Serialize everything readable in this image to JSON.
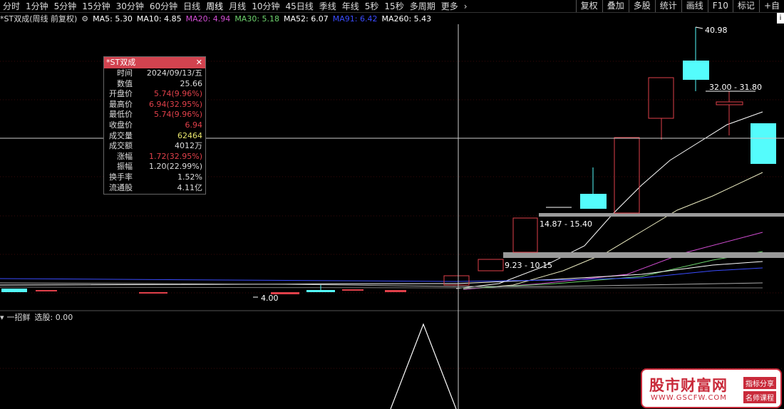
{
  "toolbar": {
    "tabs": [
      "分时",
      "1分钟",
      "5分钟",
      "15分钟",
      "30分钟",
      "60分钟",
      "日线",
      "周线",
      "月线",
      "10分钟",
      "45日线",
      "季线",
      "年线",
      "5秒",
      "15秒",
      "多周期",
      "更多"
    ],
    "active_tab": "周线",
    "right_buttons": [
      "复权",
      "叠加",
      "多股",
      "统计",
      "画线",
      "F10",
      "标记",
      "+自"
    ]
  },
  "chart": {
    "title": "*ST双成(周线 前复权)",
    "ma": [
      {
        "label": "MA5: 5.30",
        "color": "#ffffff"
      },
      {
        "label": "MA10: 4.85",
        "color": "#ffffff"
      },
      {
        "label": "MA20: 4.94",
        "color": "#d14dd2"
      },
      {
        "label": "MA30: 5.18",
        "color": "#6ed36e"
      },
      {
        "label": "MA52: 6.07",
        "color": "#ffffff"
      },
      {
        "label": "MA91: 6.42",
        "color": "#3a4cff"
      },
      {
        "label": "MA260: 5.43",
        "color": "#ffffff"
      }
    ],
    "annotations": {
      "high": "40.98",
      "range1": "32.00 - 31.80",
      "range2": "14.87 - 15.40",
      "range3": "9.23 - 10.15",
      "low": "4.00"
    },
    "up_color": "#e0404a",
    "down_color": "#54fcfc"
  },
  "info_box": {
    "title": "*ST双成",
    "rows": [
      {
        "k": "时间",
        "v": "2024/09/13/五",
        "c": ""
      },
      {
        "k": "数值",
        "v": "25.66",
        "c": ""
      },
      {
        "k": "开盘价",
        "v": "5.74(9.96%)",
        "c": "red"
      },
      {
        "k": "最高价",
        "v": "6.94(32.95%)",
        "c": "red"
      },
      {
        "k": "最低价",
        "v": "5.74(9.96%)",
        "c": "red"
      },
      {
        "k": "收盘价",
        "v": "6.94",
        "c": "red"
      },
      {
        "k": "成交量",
        "v": "62464",
        "c": "yellow"
      },
      {
        "k": "成交额",
        "v": "4012万",
        "c": ""
      },
      {
        "k": "涨幅",
        "v": "1.72(32.95%)",
        "c": "red"
      },
      {
        "k": "振幅",
        "v": "1.20(22.99%)",
        "c": ""
      },
      {
        "k": "换手率",
        "v": "1.52%",
        "c": ""
      },
      {
        "k": "流通股",
        "v": "4.11亿",
        "c": ""
      }
    ]
  },
  "indicator": {
    "name": "一招鲜",
    "value_label": "选股: 0.00"
  },
  "watermark": {
    "cn": "股市财富网",
    "url": "WWW.GSCFW.COM",
    "tag1": "指标分享",
    "tag2": "名师课程"
  }
}
